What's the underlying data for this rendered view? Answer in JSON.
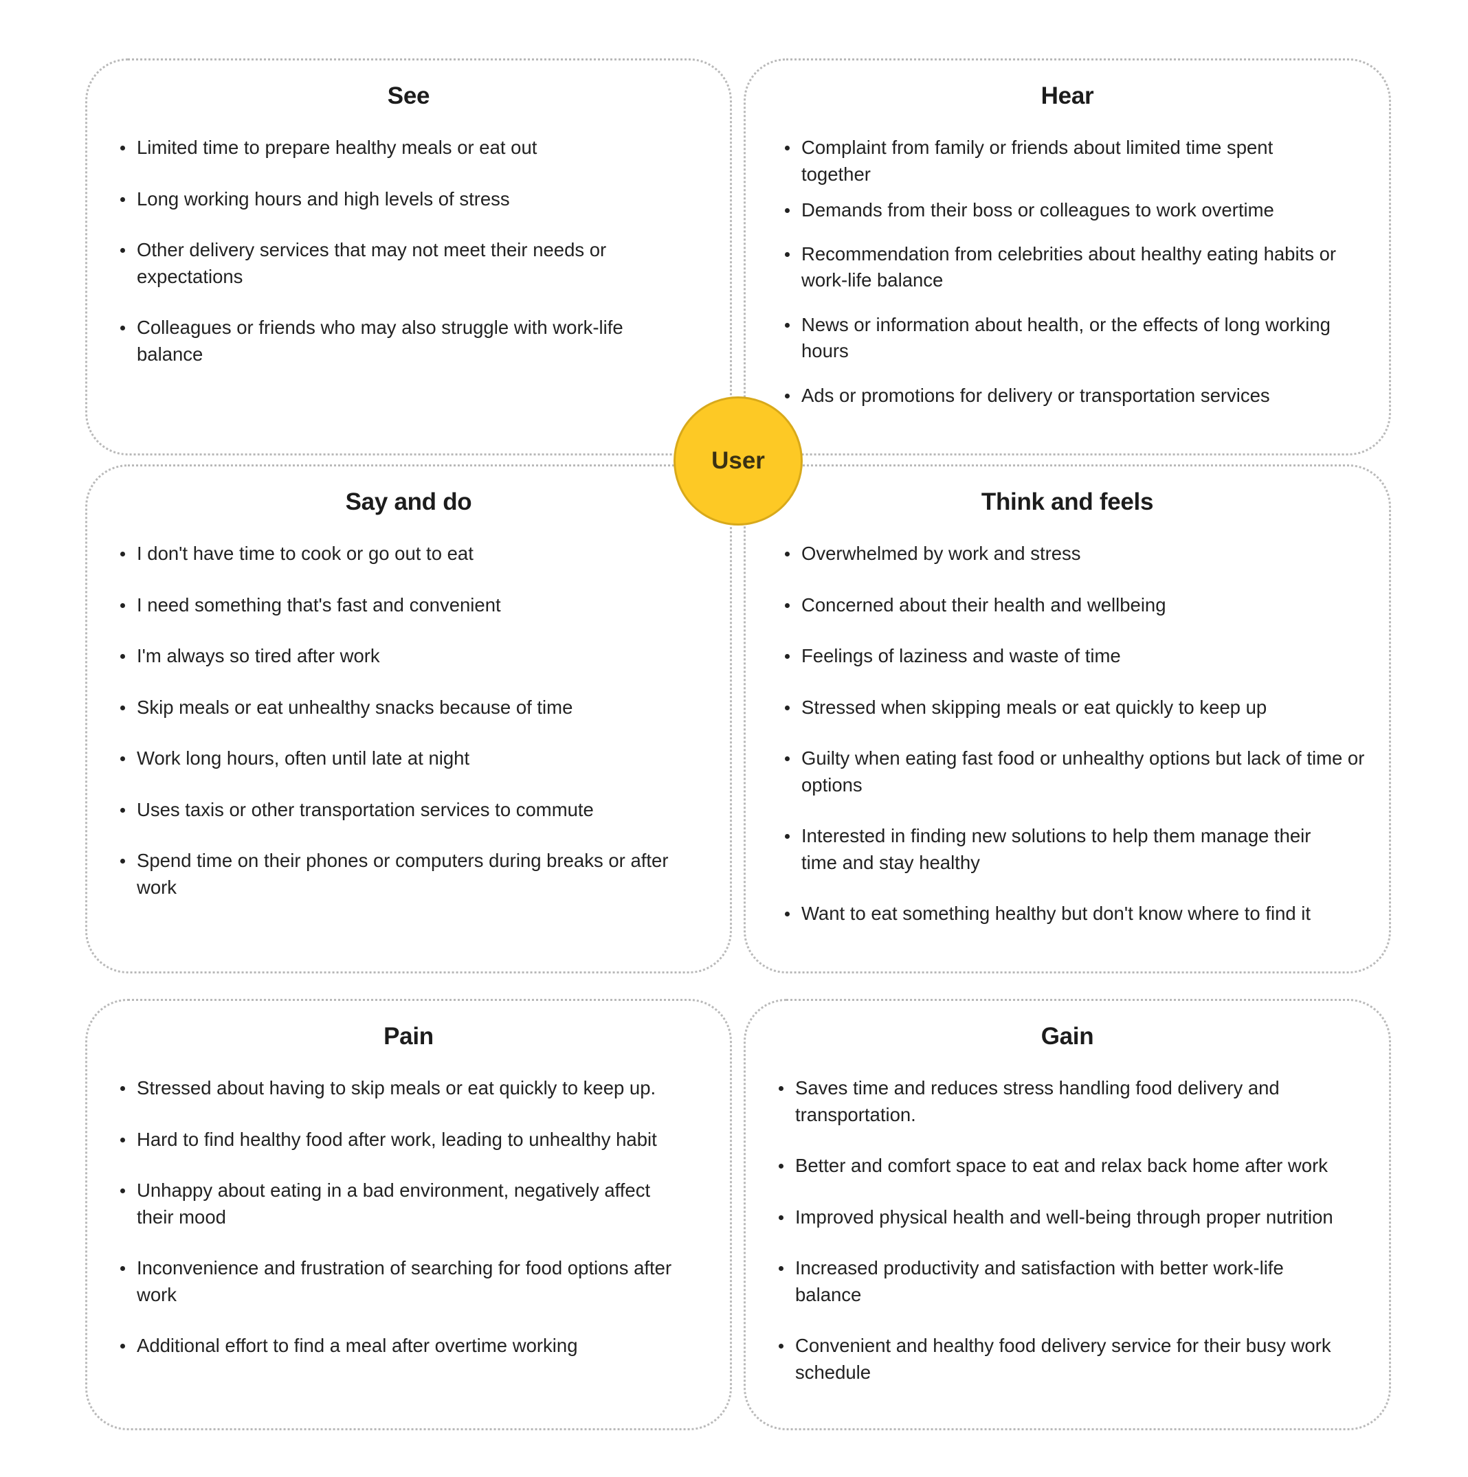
{
  "center": {
    "label": "User",
    "color": "#fdc925"
  },
  "see": {
    "title": "See",
    "items": [
      "Limited time to prepare healthy meals or eat out",
      "Long working hours and high levels of stress",
      "Other delivery services that may not meet their needs or expectations",
      "Colleagues or friends who may also struggle with work-life balance"
    ]
  },
  "hear": {
    "title": "Hear",
    "items": [
      "Complaint from family or friends about limited time spent together",
      "Demands from their boss or colleagues to work overtime",
      "Recommendation from celebrities about healthy eating habits or work-life balance",
      "News or information about health, or the effects of long working hours",
      "Ads or promotions for delivery or transportation services"
    ]
  },
  "say_do": {
    "title": "Say and do",
    "items": [
      "I don't have time to cook or go out to eat",
      "I need something that's fast and convenient",
      "I'm always so tired after work",
      "Skip meals or eat unhealthy snacks because of time",
      "Work long hours, often until late at night",
      "Uses taxis or other transportation services to commute",
      "Spend time on their phones or computers during breaks or after work"
    ]
  },
  "think_feel": {
    "title": "Think and feels",
    "items": [
      "Overwhelmed by work and stress",
      "Concerned about their health and wellbeing",
      "Feelings of laziness and waste of time",
      "Stressed when skipping meals or eat quickly to keep up",
      "Guilty when eating fast food or unhealthy options but lack of time or options",
      "Interested in finding new solutions to help them manage their time and stay healthy",
      "Want to eat something healthy but don't know where to find it"
    ]
  },
  "pain": {
    "title": "Pain",
    "items": [
      "Stressed about having to skip meals or eat quickly to keep up.",
      "Hard to find healthy food after work, leading to unhealthy habit",
      "Unhappy about eating in a bad environment, negatively affect their mood",
      "Inconvenience and frustration of searching for food options after work",
      "Additional effort to find a meal after overtime working"
    ]
  },
  "gain": {
    "title": "Gain",
    "items": [
      "Saves time and reduces stress handling food delivery and transportation.",
      "Better and comfort space to eat and relax back home after work",
      "Improved physical health and well-being through proper nutrition",
      "Increased productivity and satisfaction with better work-life balance",
      "Convenient and healthy food delivery service for their busy work schedule"
    ]
  }
}
